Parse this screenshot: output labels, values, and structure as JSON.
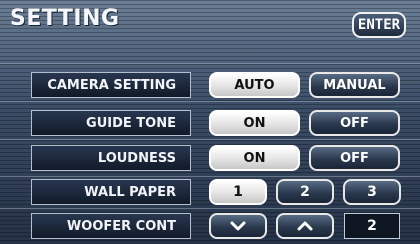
{
  "screen": {
    "title": "SETTING",
    "enter_label": "ENTER"
  },
  "rows": [
    {
      "label": "CAMERA SETTING",
      "options": [
        {
          "label": "AUTO",
          "selected": true
        },
        {
          "label": "MANUAL",
          "selected": false
        }
      ]
    },
    {
      "label": "GUIDE TONE",
      "options": [
        {
          "label": "ON",
          "selected": true
        },
        {
          "label": "OFF",
          "selected": false
        }
      ]
    },
    {
      "label": "LOUDNESS",
      "options": [
        {
          "label": "ON",
          "selected": true
        },
        {
          "label": "OFF",
          "selected": false
        }
      ]
    },
    {
      "label": "WALL PAPER",
      "options": [
        {
          "label": "1",
          "selected": true
        },
        {
          "label": "2",
          "selected": false
        },
        {
          "label": "3",
          "selected": false
        }
      ]
    },
    {
      "label": "WOOFER CONT",
      "down_icon": "chevron-down-icon",
      "up_icon": "chevron-up-icon",
      "value": "2"
    }
  ],
  "colors": {
    "background": "#3b4d66",
    "selected_button": "#e4e4e4",
    "unselected_button": "#2b394e"
  }
}
